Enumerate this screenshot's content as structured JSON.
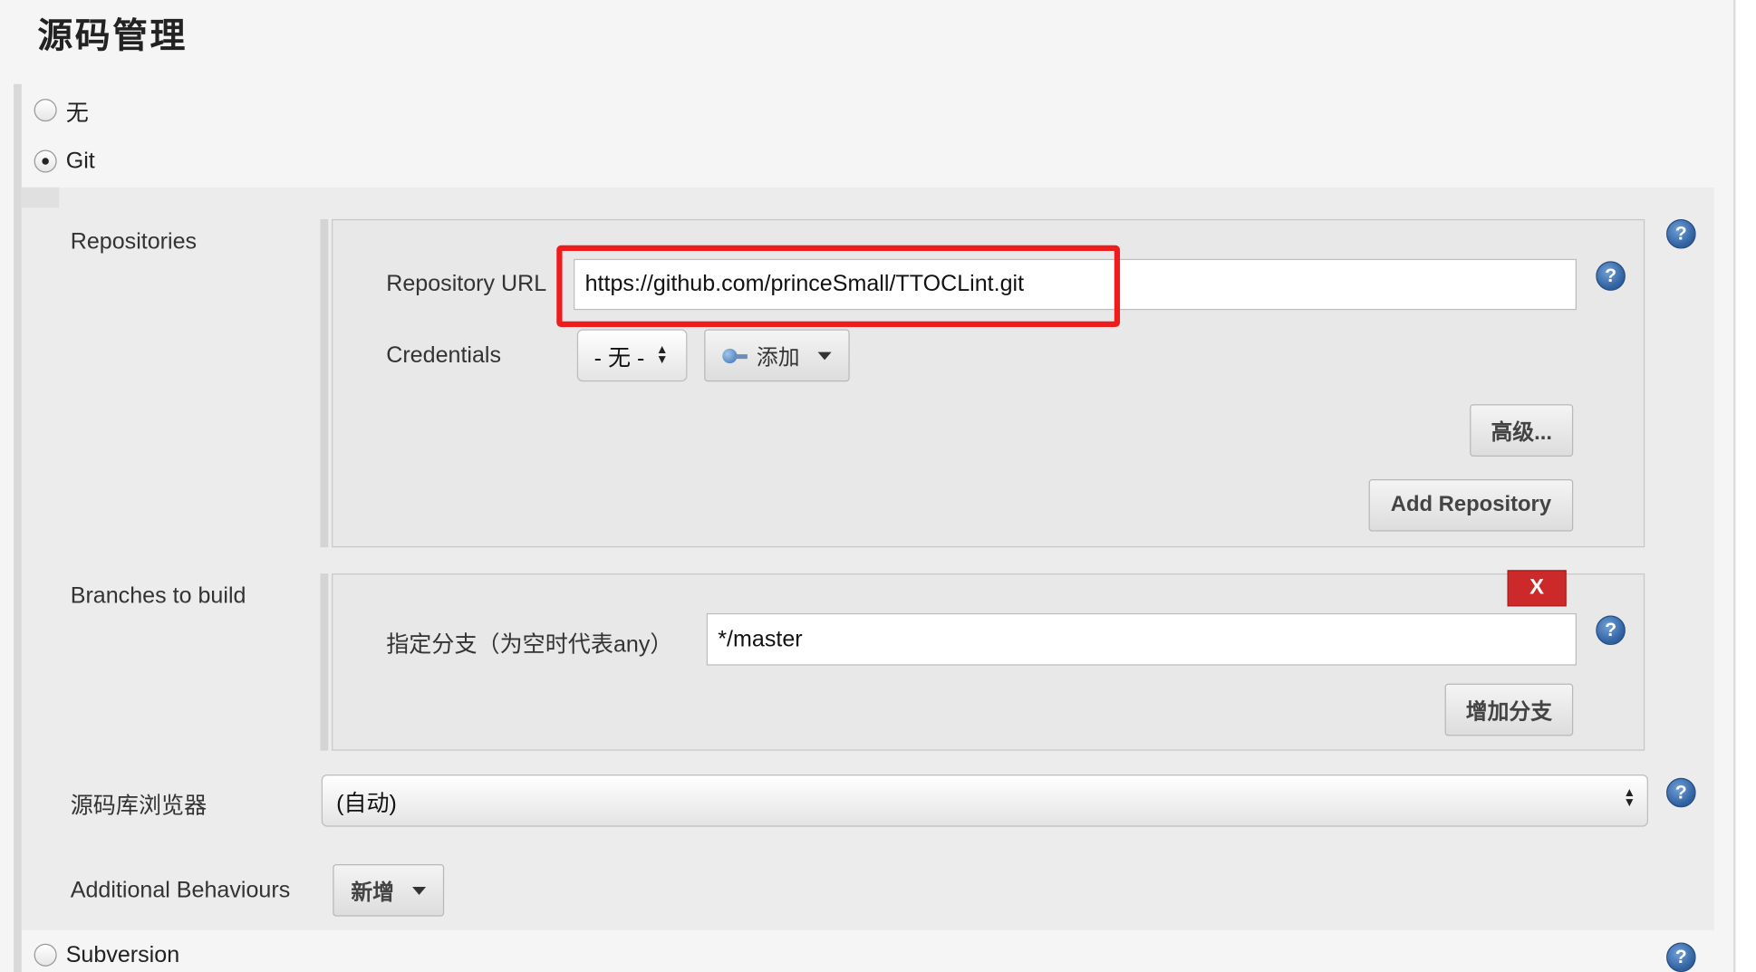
{
  "section_title": "源码管理",
  "scm_options": {
    "none_label": "无",
    "git_label": "Git",
    "subversion_label": "Subversion"
  },
  "repositories": {
    "label": "Repositories",
    "url_label": "Repository URL",
    "url_value": "https://github.com/princeSmall/TTOCLint.git",
    "credentials_label": "Credentials",
    "credentials_selected": "- 无 -",
    "add_label": "添加",
    "advanced_label": "高级...",
    "add_repository_label": "Add Repository"
  },
  "branches": {
    "label": "Branches to build",
    "delete_label": "X",
    "specifier_label": "指定分支（为空时代表any）",
    "specifier_value": "*/master",
    "add_branch_label": "增加分支"
  },
  "browser": {
    "label": "源码库浏览器",
    "selected": "(自动)"
  },
  "behaviours": {
    "label": "Additional Behaviours",
    "add_label": "新增"
  },
  "help_symbol": "?",
  "colors": {
    "highlight": "#ee1c1c",
    "delete_button": "#cc2a2a",
    "help_icon": "#2e5f9e"
  }
}
